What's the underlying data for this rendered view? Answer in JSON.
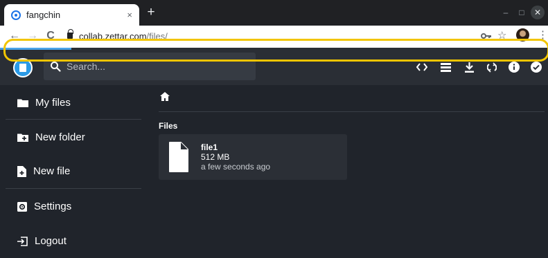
{
  "browser": {
    "tab_title": "fangchin",
    "tab_close": "×",
    "new_tab": "+",
    "url_host": "collab.zettar.com",
    "url_path": "/files/",
    "nav": {
      "back": "←",
      "forward": "→",
      "reload": "C"
    }
  },
  "search": {
    "placeholder": "Search..."
  },
  "sidebar": {
    "items": [
      {
        "label": "My files"
      },
      {
        "label": "New folder"
      },
      {
        "label": "New file"
      },
      {
        "label": "Settings"
      },
      {
        "label": "Logout"
      }
    ]
  },
  "main": {
    "section_title": "Files",
    "file": {
      "name": "file1",
      "size": "512 MB",
      "modified": "a few seconds ago"
    }
  },
  "colors": {
    "accent": "#4aa3e8",
    "highlight": "#f2c500",
    "background": "#20242b"
  }
}
